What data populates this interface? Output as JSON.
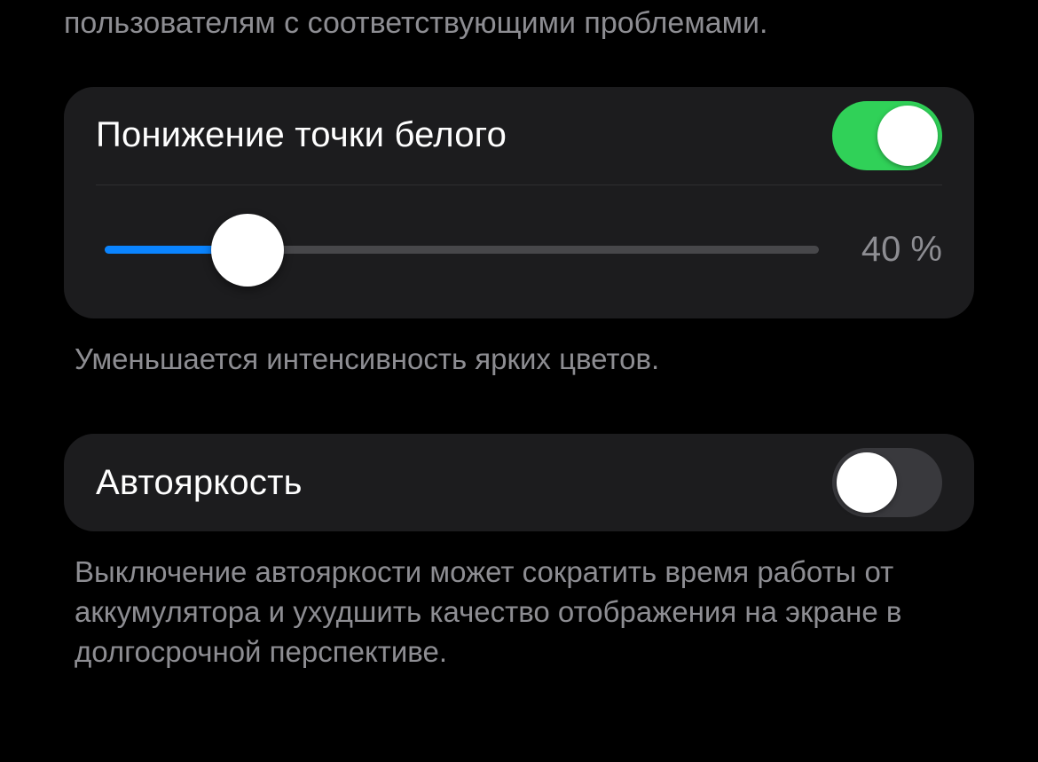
{
  "top_description": "пользователям с соответствующими проблемами.",
  "group1": {
    "title": "Понижение точки белого",
    "enabled": true,
    "slider": {
      "percent": 20,
      "display": "40 %"
    },
    "description": "Уменьшается интенсивность ярких цветов."
  },
  "group2": {
    "title": "Автояркость",
    "enabled": false,
    "description": "Выключение автояркости может сократить время работы от аккумулятора и ухудшить качество отображения на экране в долгосрочной перспективе."
  }
}
